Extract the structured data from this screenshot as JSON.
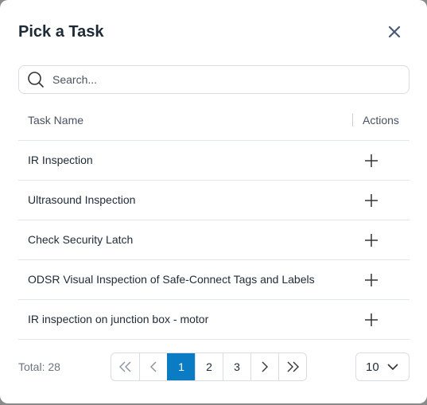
{
  "dialog": {
    "title": "Pick a Task"
  },
  "search": {
    "placeholder": "Search...",
    "value": ""
  },
  "table": {
    "columns": {
      "name": "Task Name",
      "actions": "Actions"
    },
    "rows": [
      {
        "name": "IR Inspection"
      },
      {
        "name": "Ultrasound Inspection"
      },
      {
        "name": "Check Security Latch"
      },
      {
        "name": "ODSR Visual Inspection of Safe-Connect Tags and Labels"
      },
      {
        "name": "IR inspection on junction box - motor"
      }
    ]
  },
  "footer": {
    "total_label": "Total: 28",
    "pages": [
      "1",
      "2",
      "3"
    ],
    "current_page": "1",
    "page_size": "10"
  },
  "colors": {
    "accent": "#0b7bc4",
    "text": "#1f2a37",
    "border": "#d9dde3"
  },
  "icons": {
    "close": "close-icon",
    "search": "search-icon",
    "add": "plus-icon",
    "first": "double-chevron-left-icon",
    "prev": "chevron-left-icon",
    "next": "chevron-right-icon",
    "last": "double-chevron-right-icon",
    "dropdown": "chevron-down-icon"
  }
}
